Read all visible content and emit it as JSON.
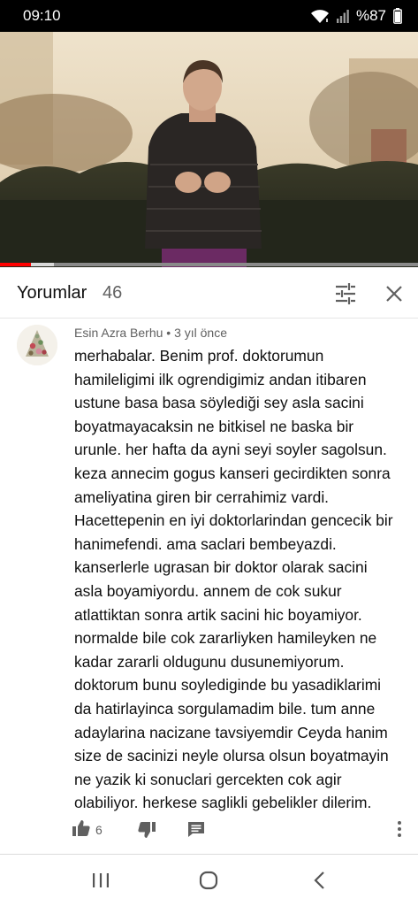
{
  "status_bar": {
    "time": "09:10",
    "battery": "%87",
    "icons": [
      "wifi-icon",
      "signal-icon"
    ]
  },
  "video": {
    "progress_fraction": 0.075,
    "buffered_fraction": 0.13
  },
  "comments": {
    "title": "Yorumlar",
    "count": "46",
    "header_icons": [
      "filter-icon",
      "close-icon"
    ]
  },
  "comment": {
    "author": "Esin Azra Berhu",
    "separator": "•",
    "time": "3 yıl önce",
    "lines": [
      "merhabalar. Benim prof. doktorumun",
      "hamileligimi ilk ogrendigimiz andan itibaren",
      "ustune basa basa söylediği sey asla sacini",
      "boyatmayacaksin ne bitkisel ne baska bir",
      "urunle. her hafta da ayni seyi soyler sagolsun.",
      "keza annecim gogus kanseri gecirdikten sonra",
      "ameliyatina giren bir cerrahimiz vardi.",
      "Hacettepenin en iyi doktorlarindan gencecik bir",
      "hanimefendi. ama saclari bembeyazdi.",
      "kanserlerle ugrasan bir doktor olarak sacini",
      "asla boyamiyordu. annem de cok sukur",
      "atlattiktan sonra artik sacini hic boyamiyor.",
      "normalde bile cok zararliyken hamileyken ne",
      "kadar zararli oldugunu dusunemiyorum.",
      "doktorum bunu soylediginde bu yasadiklarimi",
      "da hatirlayinca sorgulamadim bile. tum anne",
      "adaylarina nacizane tavsiyemdir Ceyda hanim",
      "size de sacinizi neyle olursa olsun boyatmayin",
      "ne yazik ki sonuclari gercekten cok agir",
      "olabiliyor. herkese saglikli gebelikler dilerim."
    ],
    "likes": "6",
    "action_icons": [
      "thumbs-up-icon",
      "thumbs-down-icon",
      "reply-icon",
      "more-vert-icon"
    ]
  },
  "nav_bar": {
    "icons": [
      "recents-icon",
      "home-icon",
      "back-icon"
    ]
  },
  "colors": {
    "status_bar_bg": "#000000",
    "progress_played": "#ff0000",
    "secondary_text": "#606060",
    "primary_text": "#0f0f0f"
  }
}
